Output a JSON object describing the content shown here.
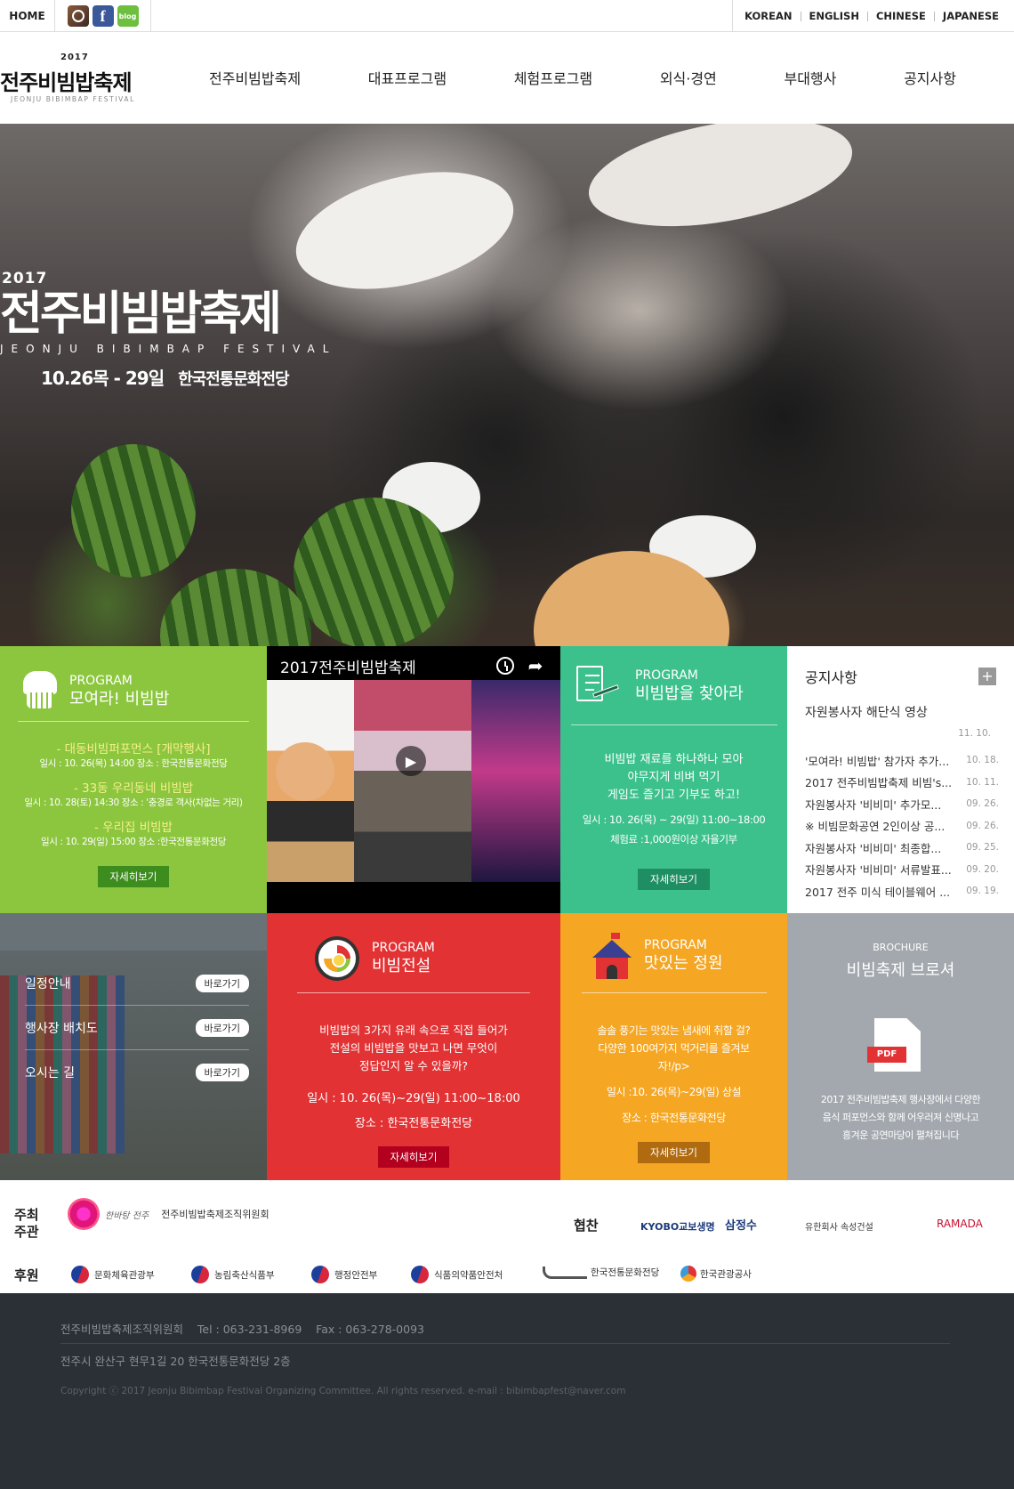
{
  "topbar": {
    "home": "HOME",
    "social": [
      {
        "icon": "instagram-icon",
        "label": ""
      },
      {
        "icon": "facebook-icon",
        "label": "f"
      },
      {
        "icon": "blog-icon",
        "label": "blog"
      }
    ],
    "languages": [
      "KOREAN",
      "ENGLISH",
      "CHINESE",
      "JAPANESE"
    ]
  },
  "logo": {
    "year": "2017",
    "name_kr": "전주비빔밥축제",
    "name_en": "JEONJU BIBIMBAP FESTIVAL"
  },
  "nav": [
    "전주비빔밥축제",
    "대표프로그램",
    "체험프로그램",
    "외식·경연",
    "부대행사",
    "공지사항"
  ],
  "hero": {
    "year": "2017",
    "title": "전주비빔밥축제",
    "subtitle_en": "JEONJU BIBIMBAP FESTIVAL",
    "dates": "10.26목 - 29일",
    "venue": "한국전통문화전당"
  },
  "program_gather": {
    "kicker": "PROGRAM",
    "title": "모여라! 비빔밥",
    "items": [
      {
        "title": "- 대동비빔퍼포먼스 [개막행사]",
        "detail": "일시 : 10. 26(목) 14:00 장소 : 한국전통문화전당"
      },
      {
        "title": "- 33동 우리동네 비빔밥",
        "detail": "일시 : 10. 28(토) 14:30 장소 : '충경로 객사(차없는 거리)"
      },
      {
        "title": "- 우리집 비빔밥",
        "detail": "일시 : 10. 29(일) 15:00 장소 :한국전통문화전당"
      }
    ],
    "button": "자세히보기"
  },
  "video": {
    "title": "2017전주비빔밥축제"
  },
  "program_find": {
    "kicker": "PROGRAM",
    "title": "비빔밥을 찾아라",
    "body": [
      "비빔밥 재료를 하나하나 모아",
      "야무지게 비벼 먹기",
      "게임도 즐기고 기부도 하고!"
    ],
    "info": [
      "일시 : 10. 26(목) ~ 29(일) 11:00~18:00",
      "체험료 :1,000원이상 자율기부"
    ],
    "button": "자세히보기"
  },
  "notice": {
    "title": "공지사항",
    "first": {
      "title": "자원봉사자 해단식 영상",
      "date": "11. 10."
    },
    "rows": [
      {
        "title": "'모여라! 비빔밥' 참가자 추가...",
        "date": "10. 18."
      },
      {
        "title": "2017 전주비빔밥축제 비빔's...",
        "date": "10. 11."
      },
      {
        "title": "자원봉사자 '비비미' 추가모...",
        "date": "09. 26."
      },
      {
        "title": "※ 비빔문화공연 2인이상 공...",
        "date": "09. 26."
      },
      {
        "title": "자원봉사자 '비비미' 최종합...",
        "date": "09. 25."
      },
      {
        "title": "자원봉사자 '비비미' 서류발표...",
        "date": "09. 20."
      },
      {
        "title": "2017 전주 미식 테이블웨어 ...",
        "date": "09. 19."
      }
    ]
  },
  "quicklinks": [
    {
      "label": "일정안내",
      "button": "바로가기"
    },
    {
      "label": "행사장 배치도",
      "button": "바로가기"
    },
    {
      "label": "오시는 길",
      "button": "바로가기"
    }
  ],
  "program_legend": {
    "kicker": "PROGRAM",
    "title": "비빔전설",
    "body": [
      "비빔밥의 3가지 유래 속으로 직접 들어가",
      "전설의 비빔밥을 맛보고 나면 무엇이",
      "정답인지 알 수 있을까?"
    ],
    "info": [
      "일시 : 10. 26(목)~29(일) 11:00~18:00",
      "장소 : 한국전통문화전당"
    ],
    "button": "자세히보기"
  },
  "program_garden": {
    "kicker": "PROGRAM",
    "title": "맛있는 정원",
    "body": [
      "솔솔 풍기는 맛있는 냄새에 취할 걸?",
      "다양한 100여가지 먹거리를 즐겨보",
      "자!/p>"
    ],
    "info": [
      "일시 :10. 26(목)~29(일) 상설",
      "장소 : 한국전통문화전당"
    ],
    "button": "자세히보기"
  },
  "brochure": {
    "kicker": "BROCHURE",
    "title": "비빔축제 브로셔",
    "pdf": "PDF",
    "body": [
      "2017 전주비빔밥축제 행사장에서 다양한",
      "음식 퍼포먼스와 함께 어우러져 신명나고",
      "흥겨운 공연마당이 펼쳐집니다"
    ]
  },
  "sponsors": {
    "host_label_1": "주최",
    "host_label_2": "주관",
    "host_name": "전주비빔밥축제조직위원회",
    "coop_label": "협찬",
    "coop": [
      "KYOBO교보생명",
      "삼정수",
      "유한회사 속성건설",
      "RAMADA"
    ],
    "support_label": "후원",
    "support": [
      "문화체육관광부",
      "농림축산식품부",
      "행정안전부",
      "식품의약품안전처",
      "한국전통문화전당",
      "한국관광공사"
    ]
  },
  "footer": {
    "line1": "전주비빔밥축제조직위원회    Tel : 063-231-8969    Fax : 063-278-0093",
    "line2": "전주시 완산구 현무1길 20 한국전통문화전당 2층",
    "copyright": "Copyright ⓒ 2017 Jeonju Bibimbap Festival Organizing Committee. All rights reserved. e-mail : bibimbapfest@naver.com"
  },
  "colors": {
    "green": "#8cc63f",
    "teal": "#3cc18c",
    "red": "#e23234",
    "orange": "#f5a623",
    "gray": "#a3a8ae",
    "footer": "#2b2f36"
  }
}
